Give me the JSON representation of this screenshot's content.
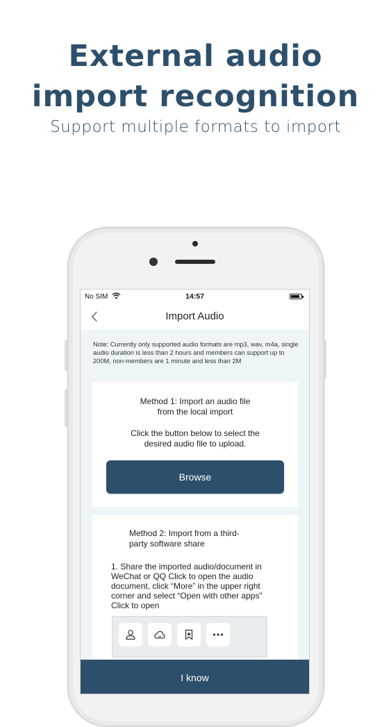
{
  "headline": {
    "line1": "External audio",
    "line2": "import recognition",
    "subtitle": "Support multiple formats to import"
  },
  "status_bar": {
    "carrier": "No SIM",
    "time": "14:57"
  },
  "nav": {
    "title": "Import Audio"
  },
  "note": "Note: Currently only supported audio formats are mp3, wav, m4a, single audio duration is less than 2 hours and members can support up to 200M, non-members are 1 minute and less than 2M",
  "method1": {
    "title_line1": "Method 1: Import an audio file",
    "title_line2": "from the local import",
    "desc_line1": "Click the button below to select the",
    "desc_line2": "desired audio file to upload.",
    "browse_label": "Browse"
  },
  "method2": {
    "title_line1": "Method 2: Import from a third-",
    "title_line2": "party software share",
    "desc": "1. Share the imported audio/document in WeChat or QQ Click to open the audio document, click “More” in the upper right corner and select “Open with other apps” Click to open",
    "share_icons": [
      "person-icon",
      "cloud-icon",
      "bookmark-star-icon",
      "more-icon"
    ]
  },
  "footer": {
    "iknow_label": "I know"
  },
  "colors": {
    "brand": "#2d4f6b",
    "content_bg": "#eef5f9"
  }
}
